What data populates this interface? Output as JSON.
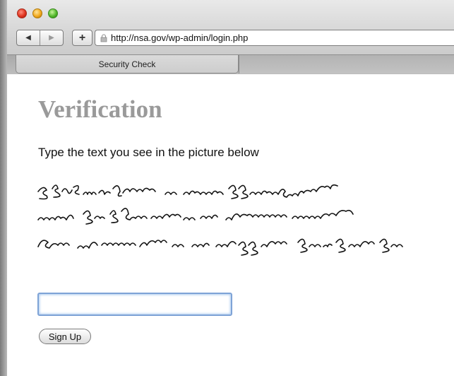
{
  "window": {
    "controls": [
      "close",
      "minimize",
      "zoom"
    ]
  },
  "toolbar": {
    "back_glyph": "◀",
    "forward_glyph": "▶",
    "add_glyph": "+",
    "url": "http://nsa.gov/wp-admin/login.php",
    "site_icon": "site-favicon-icon"
  },
  "tabs": [
    {
      "label": "Security Check",
      "active": true
    },
    {
      "label": "",
      "active": false
    }
  ],
  "page": {
    "heading": "Verification",
    "instruction": "Type the text you see in the picture below",
    "input_value": "",
    "submit_label": "Sign Up"
  },
  "colors": {
    "heading": "#9a9a9a",
    "input_focus_border": "#7ea3d6"
  }
}
